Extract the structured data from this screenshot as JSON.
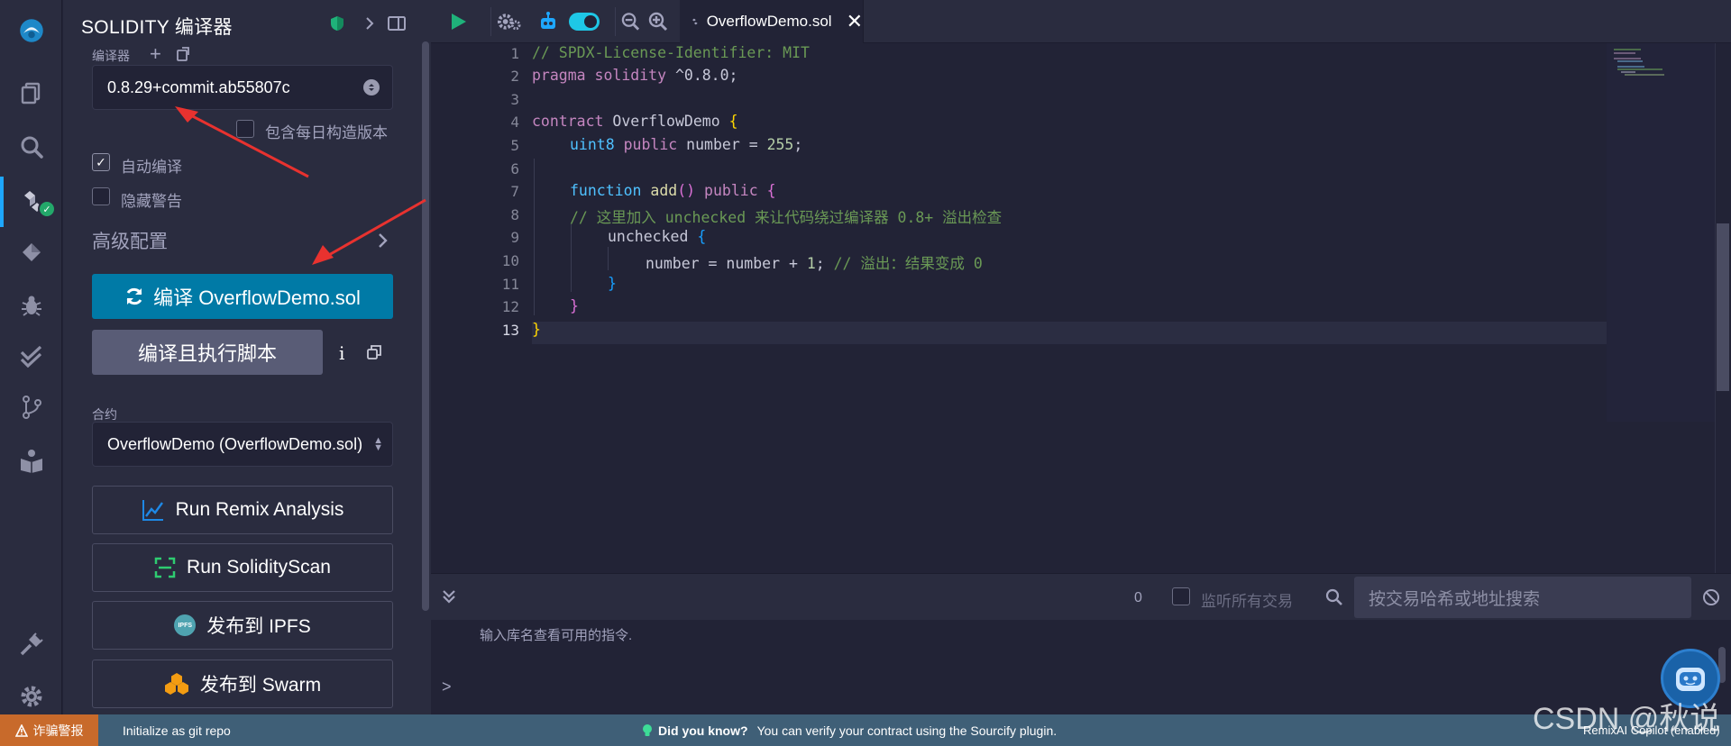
{
  "panel": {
    "title": "SOLIDITY 编译器",
    "compiler_label": "编译器",
    "compiler_version": "0.8.29+commit.ab55807c",
    "nightly_label": "包含每日构造版本",
    "auto_compile_label": "自动编译",
    "hide_warnings_label": "隐藏警告",
    "advanced_label": "高级配置",
    "compile_button": "编译 OverflowDemo.sol",
    "compile_run_button": "编译且执行脚本",
    "info_glyph": "i",
    "contract_label": "合约",
    "contract_value": "OverflowDemo (OverflowDemo.sol)",
    "remix_analysis": "Run Remix Analysis",
    "solidity_scan": "Run SolidityScan",
    "ipfs_badge": "IPFS",
    "publish_ipfs": "发布到 IPFS",
    "publish_swarm": "发布到 Swarm"
  },
  "editor": {
    "tab_name": "OverflowDemo.sol",
    "line_numbers": [
      "1",
      "2",
      "3",
      "4",
      "5",
      "6",
      "7",
      "8",
      "9",
      "10",
      "11",
      "12",
      "13"
    ],
    "code": {
      "l1": "// SPDX-License-Identifier: MIT",
      "l2_kw": "pragma solidity",
      "l2_rest": " ^0.8.0;",
      "l4_kw": "contract",
      "l4_name": " OverflowDemo ",
      "l4_br": "{",
      "l5_ty": "uint8",
      "l5_kw": " public",
      "l5_rest": " number = ",
      "l5_num": "255",
      "l5_end": ";",
      "l7_kw": "function",
      "l7_fn": " add",
      "l7_paren": "()",
      "l7_pub": " public",
      "l7_br": " {",
      "l8": "// 这里加入 unchecked 来让代码绕过编译器 0.8+ 溢出检查",
      "l9_kw": "unchecked",
      "l9_br": " {",
      "l10_a": "number = number + ",
      "l10_num": "1",
      "l10_b": "; ",
      "l10_cmt": "// 溢出：结果变成 0",
      "l11": "}",
      "l12": "}",
      "l13": "}"
    }
  },
  "terminal": {
    "tx_count": "0",
    "listen_label": "监听所有交易",
    "search_placeholder": "按交易哈希或地址搜索",
    "hint": "输入库名查看可用的指令.",
    "prompt": ">"
  },
  "status": {
    "scam_alert": "诈骗警报",
    "git_init": "Initialize as git repo",
    "did_you_know": "Did you know?",
    "tip": "You can verify your contract using the Sourcify plugin.",
    "copilot": "RemixAI Copilot (enabled)"
  },
  "watermark": "CSDN @秋说",
  "colors": {
    "accent": "#007aa6",
    "panel_bg": "#2a2c3f",
    "editor_bg": "#222336",
    "status_bg": "#3f5f77",
    "scam_bg": "#c86a2b"
  }
}
